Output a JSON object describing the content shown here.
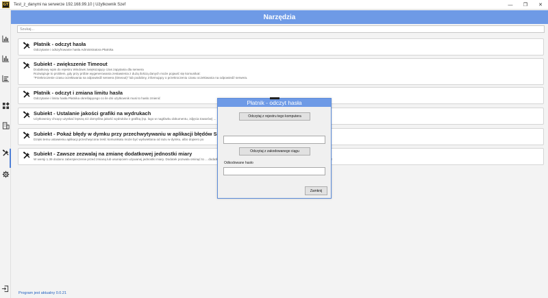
{
  "window": {
    "logo_text": "GT",
    "title": "Test_z_danymi na serwerze 192.168.99.10 | Użytkownik Szef",
    "controls": [
      "—",
      "❐",
      "✕"
    ]
  },
  "header": {
    "title": "Narzędzia"
  },
  "search": {
    "placeholder": "Szukaj..."
  },
  "sidebar": {
    "items": [
      {
        "icon": "bar-chart-icon",
        "active": false
      },
      {
        "icon": "bar-chart-icon",
        "active": false
      },
      {
        "icon": "report-icon",
        "active": false
      },
      {
        "icon": "apps-grid-icon",
        "active": false
      },
      {
        "icon": "building-icon",
        "active": false
      },
      {
        "icon": "tools-icon",
        "active": true
      },
      {
        "icon": "gear-icon",
        "active": false
      }
    ],
    "exit_icon": "exit-icon"
  },
  "tools": [
    {
      "title": "Płatnik - odczyt hasła",
      "desc": [
        "Odczytanie i odszyfrowanie hasła Administratora Płatnika"
      ]
    },
    {
      "title": "Subiekt - zwiększenie Timeout",
      "desc": [
        "Dodatkowy wpis do rejestru Windows zwiększający czas zapytania dla serwera",
        "Rozwiązuje to problem, gdy przy próbie wygenerowania zestawienia z dużą ilością danych może pojawić się komunikat:",
        "\"Przekroczenie czasu oczekiwania na odpowiedź serwera (timeout)\" lub podobny, informujący o przekroczeniu czasu oczekiwania na odpowiedź serwera."
      ]
    },
    {
      "title": "Płatnik - odczyt i zmiana limitu hasła",
      "desc": [
        "Odczytanie i limitu hasła Płatnika określającego co ile dni użytkownik musi to hasło zmienić"
      ]
    },
    {
      "title": "Subiekt - Ustalanie jakości grafiki na wydrukach",
      "desc": [
        "Użytkownicy chcący uzyskać lepszą niż domyślna jakość wydruków z grafiką (np. logo w nagłówku dokumentu, zdjęcia towarów) ... w rejestrze systemowym dla mechanizmu wydruków Crystal Reports (R)."
      ]
    },
    {
      "title": "Subiekt - Pokaż błędy w dymku przy przechwytywaniu w aplikacji błędów SQL Server",
      "desc": [
        "Dzięki temu ustawieniu aplikacji przechwycona treść komunikatu może być wyświetlana od razu w dymku, albo dopiero po"
      ]
    },
    {
      "title": "Subiekt - Zawsze zezwalaj na zmianę dodatkowej jednostki miary",
      "desc": [
        "W wersji 1.39 dodano zabezpieczenie przed zmianą lub usunięciem używanej jednostki miary. Dodatek pozwala ominąć to ... dodatkowej jednostki miary w przypadku kiedy towar posiada historię na dokumentach 1!"
      ]
    }
  ],
  "footer": {
    "status": "Program jest aktualny 0.0.21"
  },
  "dialog": {
    "title": "Płatnik - odczyt hasła",
    "btn_registry": "Odczytaj z rejestru tego komputera",
    "input1_value": "",
    "btn_encoded": "Odczytaj z zakodowanego ciągu",
    "decoded_label": "Odkodowane hasło",
    "input2_value": "",
    "btn_close": "Zamknij"
  },
  "colors": {
    "accent": "#6e9ae6",
    "status_link": "#1f5fbf",
    "active_bar": "#4e7fd6"
  }
}
